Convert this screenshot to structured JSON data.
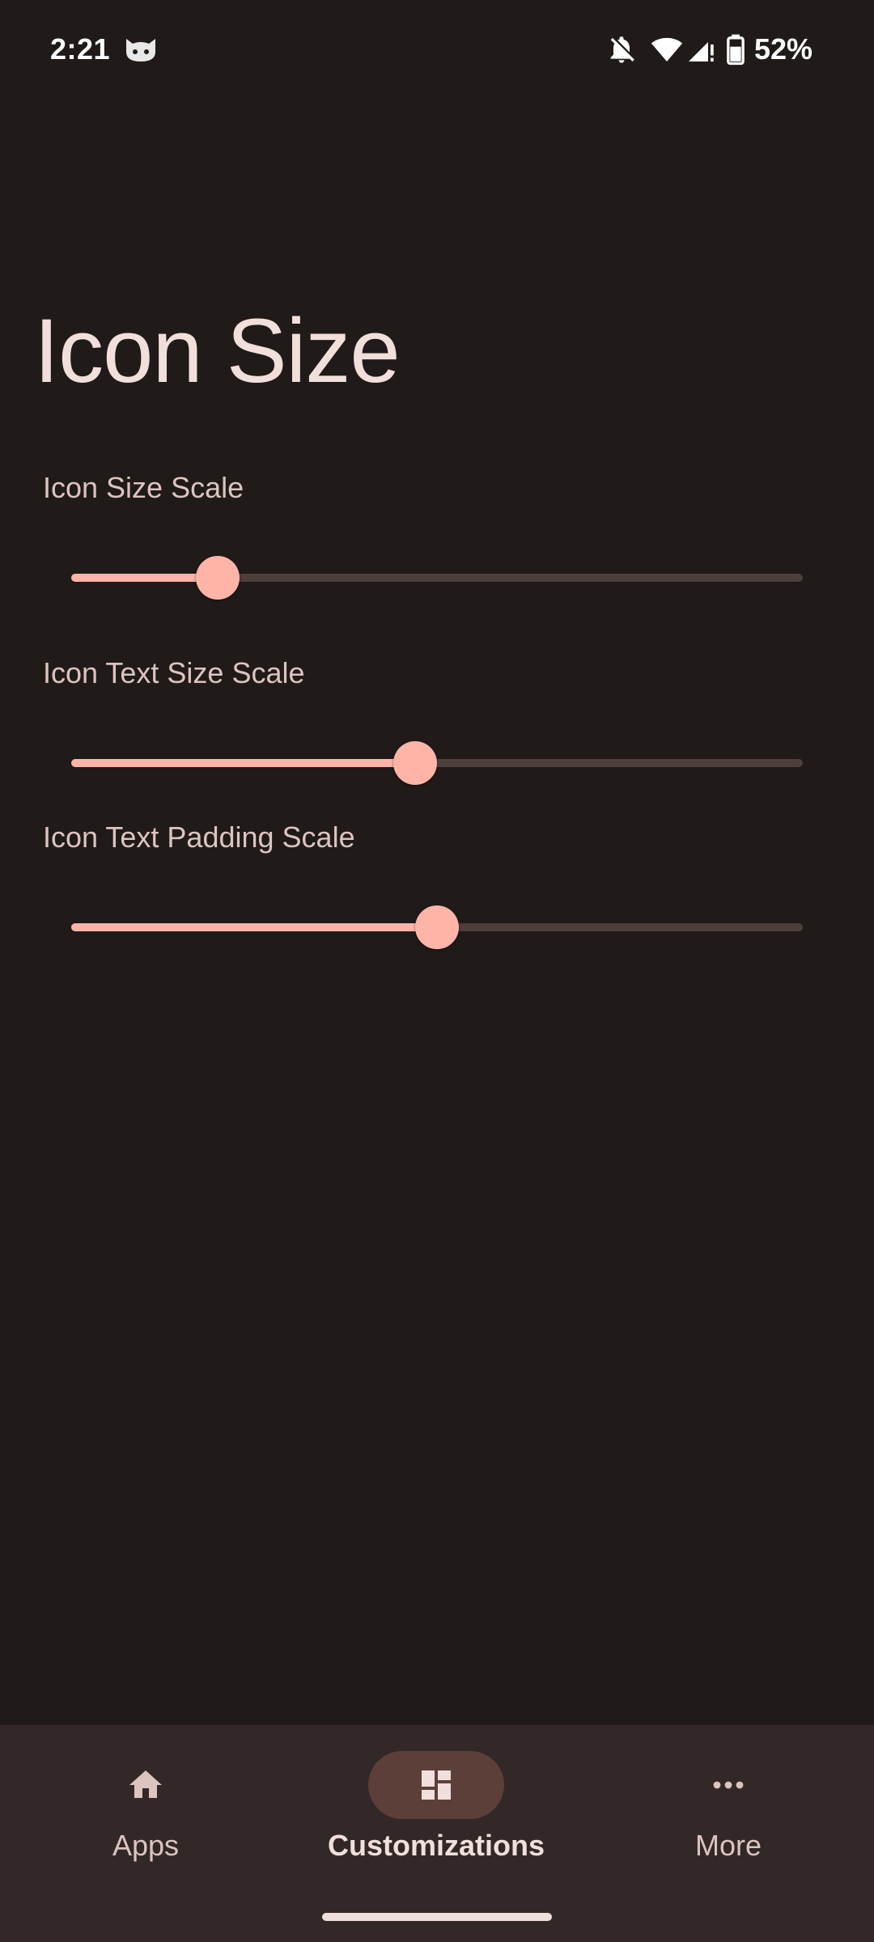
{
  "status_bar": {
    "time": "2:21",
    "battery": "52%",
    "icons": [
      "cat-notification-icon",
      "bell-off-icon",
      "wifi-icon",
      "cell-signal-icon",
      "battery-icon"
    ]
  },
  "page": {
    "title": "Icon Size"
  },
  "settings": {
    "icon_size_scale": {
      "label": "Icon Size Scale",
      "value_fraction": 0.2
    },
    "icon_text_size_scale": {
      "label": "Icon Text Size Scale",
      "value_fraction": 0.47
    },
    "icon_text_padding_scale": {
      "label": "Icon Text Padding Scale",
      "value_fraction": 0.5
    }
  },
  "bottom_nav": {
    "items": [
      {
        "label": "Apps",
        "icon": "home-icon",
        "active": false
      },
      {
        "label": "Customizations",
        "icon": "dashboard-icon",
        "active": true
      },
      {
        "label": "More",
        "icon": "more-horiz-icon",
        "active": false
      }
    ]
  },
  "colors": {
    "background": "#201a19",
    "accent": "#ffb4a8",
    "track_inactive": "#4d3f3c",
    "nav_background": "#322827",
    "nav_active_pill": "#5d3f3a"
  }
}
